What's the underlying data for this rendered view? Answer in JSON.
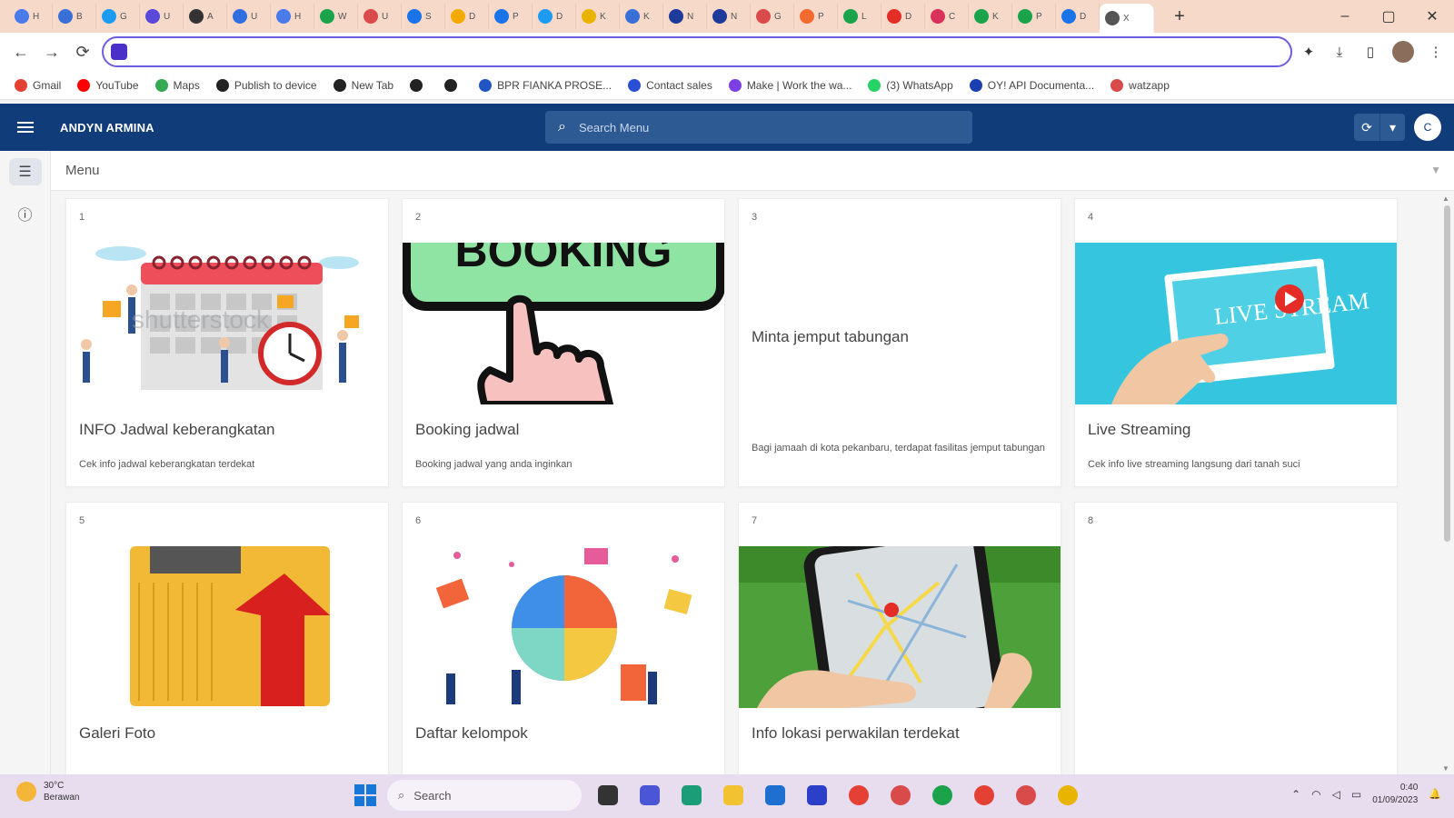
{
  "browser": {
    "tabs": [
      {
        "label": "H",
        "color": "#4a7be8"
      },
      {
        "label": "B",
        "color": "#3a6fd8"
      },
      {
        "label": "G",
        "color": "#1d9bf0"
      },
      {
        "label": "U",
        "color": "#5a48d8"
      },
      {
        "label": "A",
        "color": "#333333"
      },
      {
        "label": "U",
        "color": "#2f6fe0"
      },
      {
        "label": "H",
        "color": "#4a7be8"
      },
      {
        "label": "W",
        "color": "#1aa34a"
      },
      {
        "label": "U",
        "color": "#d94a4a"
      },
      {
        "label": "S",
        "color": "#1a73e8"
      },
      {
        "label": "D",
        "color": "#f2a900"
      },
      {
        "label": "P",
        "color": "#1a73e8"
      },
      {
        "label": "D",
        "color": "#1d9bf0"
      },
      {
        "label": "K",
        "color": "#e8b400"
      },
      {
        "label": "K",
        "color": "#3a6fd8"
      },
      {
        "label": "N",
        "color": "#1e3a9a"
      },
      {
        "label": "N",
        "color": "#1e3a9a"
      },
      {
        "label": "G",
        "color": "#d94a4a"
      },
      {
        "label": "P",
        "color": "#f26a2e"
      },
      {
        "label": "L",
        "color": "#1aa34a"
      },
      {
        "label": "D",
        "color": "#e52d27"
      },
      {
        "label": "C",
        "color": "#d8325a"
      },
      {
        "label": "K",
        "color": "#1aa34a"
      },
      {
        "label": "P",
        "color": "#1aa34a"
      },
      {
        "label": "D",
        "color": "#1a73e8"
      }
    ],
    "active_tab": {
      "label": "X",
      "color": "#555555"
    },
    "new_tab": "+",
    "window_controls": {
      "minimize": "–",
      "maximize": "▢",
      "close": "✕"
    },
    "nav": {
      "back": "←",
      "forward": "→",
      "reload": "⟳"
    },
    "toolbar_icons": {
      "extensions": "✦",
      "download": "⤓",
      "sidepanel": "▯",
      "menu": "⋮"
    },
    "bookmarks": [
      {
        "label": "Gmail",
        "color": "#e44134"
      },
      {
        "label": "YouTube",
        "color": "#ff0000"
      },
      {
        "label": "Maps",
        "color": "#34a853"
      },
      {
        "label": "Publish to device",
        "color": "#222222"
      },
      {
        "label": "New Tab",
        "color": "#222222"
      },
      {
        "label": "",
        "color": "#222222"
      },
      {
        "label": "",
        "color": "#222222"
      },
      {
        "label": "BPR FIANKA PROSE...",
        "color": "#2255c4"
      },
      {
        "label": "Contact sales",
        "color": "#2a4fd6"
      },
      {
        "label": "Make | Work the wa...",
        "color": "#7b3fe4"
      },
      {
        "label": "(3) WhatsApp",
        "color": "#25d366"
      },
      {
        "label": "OY! API Documenta...",
        "color": "#1a3fb0"
      },
      {
        "label": "watzapp",
        "color": "#d94a4a"
      }
    ]
  },
  "app": {
    "title": "ANDYN ARMINA",
    "search_placeholder": "Search Menu",
    "search_icon": "⌕",
    "refresh_icon": "⟳",
    "dropdown_icon": "▾",
    "user_initial": "C",
    "rail": {
      "menu_icon": "☰",
      "info_icon": "ⓘ"
    },
    "content_header": {
      "label": "Menu",
      "caret": "▼"
    }
  },
  "cards": [
    {
      "num": "1",
      "title": "INFO Jadwal keberangkatan",
      "desc": "Cek info jadwal keberangkatan terdekat",
      "image": "calendar-illustration",
      "watermark": "shutterstock"
    },
    {
      "num": "2",
      "title": "Booking jadwal",
      "desc": "Booking jadwal yang anda inginkan",
      "image": "booking-button-illustration",
      "image_text": "BOOKING"
    },
    {
      "num": "3",
      "title": "Minta jemput tabungan",
      "desc": "Bagi jamaah di kota pekanbaru, terdapat fasilitas jemput tabungan",
      "image": ""
    },
    {
      "num": "4",
      "title": "Live Streaming",
      "desc": "Cek info live streaming langsung dari tanah suci",
      "image": "live-stream-illustration",
      "image_text": "LIVE STREAM"
    },
    {
      "num": "5",
      "title": "Galeri Foto",
      "desc": "",
      "image": "folder-upload-illustration"
    },
    {
      "num": "6",
      "title": "Daftar kelompok",
      "desc": "",
      "image": "puzzle-team-illustration"
    },
    {
      "num": "7",
      "title": "Info lokasi perwakilan terdekat",
      "desc": "",
      "image": "map-phone-illustration"
    },
    {
      "num": "8",
      "title": "",
      "desc": "",
      "image": ""
    }
  ],
  "taskbar": {
    "weather_temp": "30°C",
    "weather_desc": "Berawan",
    "search_placeholder": "Search",
    "time": "0:40",
    "date": "01/09/2023",
    "apps": [
      {
        "name": "task-view",
        "color": "#333333"
      },
      {
        "name": "chat",
        "color": "#4a56d6"
      },
      {
        "name": "edge",
        "color": "#1b9e77"
      },
      {
        "name": "file-explorer",
        "color": "#f2c230"
      },
      {
        "name": "mail",
        "color": "#1f6fd1"
      },
      {
        "name": "app-blue",
        "color": "#2b3fc9"
      },
      {
        "name": "chrome",
        "color": "#e44134"
      },
      {
        "name": "chrome-profile-1",
        "color": "#d94a4a"
      },
      {
        "name": "chrome-profile-2",
        "color": "#1aa34a"
      },
      {
        "name": "chrome-profile-3",
        "color": "#e44134"
      },
      {
        "name": "chrome-profile-4",
        "color": "#d94a4a"
      },
      {
        "name": "chrome-profile-5",
        "color": "#e8b400"
      }
    ],
    "tray_icons": {
      "chevron": "⌃",
      "wifi": "◠",
      "volume": "◁",
      "battery": "▭",
      "bell": "🔔"
    }
  }
}
